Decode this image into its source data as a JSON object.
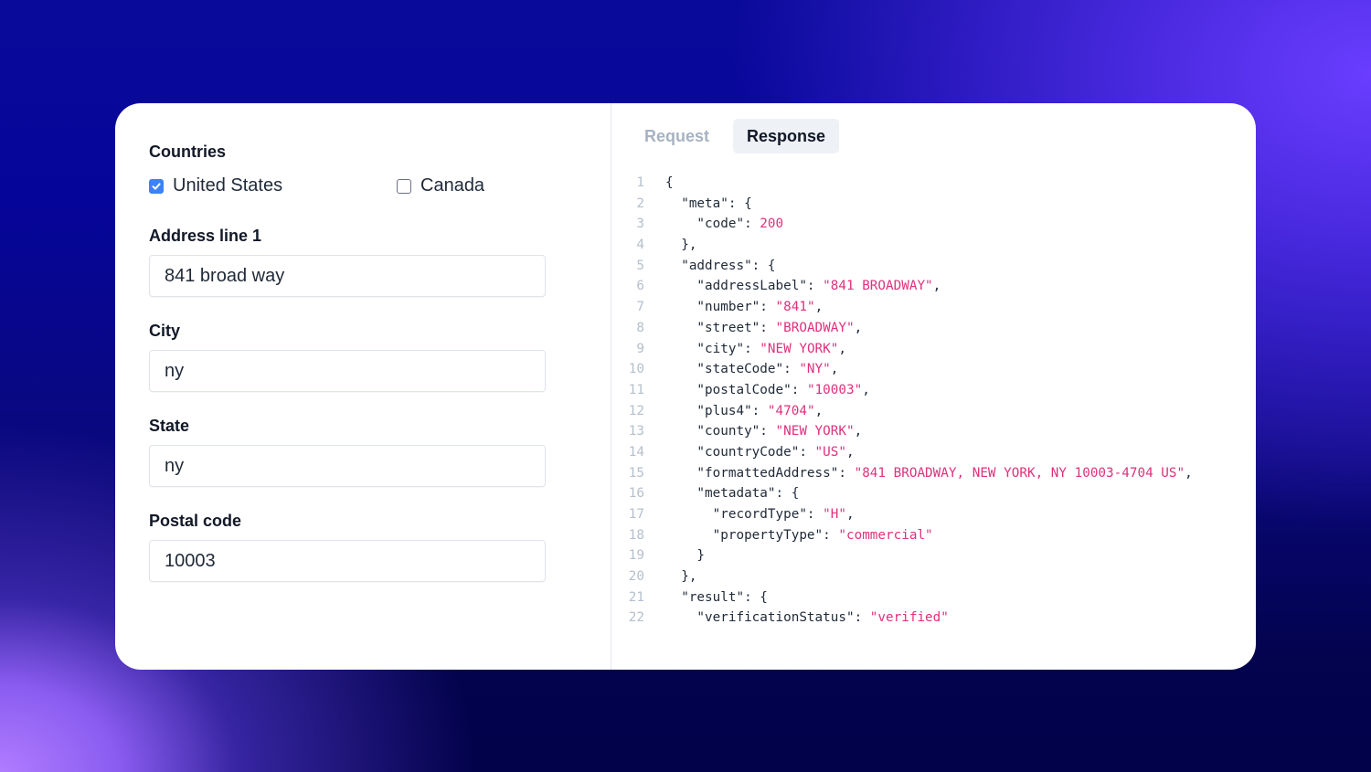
{
  "form": {
    "countries_label": "Countries",
    "countries": [
      {
        "label": "United States",
        "checked": true
      },
      {
        "label": "Canada",
        "checked": false
      }
    ],
    "address_label": "Address line 1",
    "address_value": "841 broad way",
    "city_label": "City",
    "city_value": "ny",
    "state_label": "State",
    "state_value": "ny",
    "postal_label": "Postal code",
    "postal_value": "10003"
  },
  "tabs": [
    {
      "label": "Request",
      "active": false
    },
    {
      "label": "Response",
      "active": true
    }
  ],
  "colors": {
    "accent": "#3b82f6",
    "string": "#e0307c",
    "tab_active_bg": "#eef1f6"
  },
  "code_lines": [
    [
      {
        "t": "{",
        "c": "tx"
      }
    ],
    [
      {
        "t": "  \"meta\": {",
        "c": "tx"
      }
    ],
    [
      {
        "t": "    \"code\": ",
        "c": "tx"
      },
      {
        "t": "200",
        "c": "str"
      }
    ],
    [
      {
        "t": "  },",
        "c": "tx"
      }
    ],
    [
      {
        "t": "  \"address\": {",
        "c": "tx"
      }
    ],
    [
      {
        "t": "    \"addressLabel\": ",
        "c": "tx"
      },
      {
        "t": "\"841 BROADWAY\"",
        "c": "str"
      },
      {
        "t": ",",
        "c": "tx"
      }
    ],
    [
      {
        "t": "    \"number\": ",
        "c": "tx"
      },
      {
        "t": "\"841\"",
        "c": "str"
      },
      {
        "t": ",",
        "c": "tx"
      }
    ],
    [
      {
        "t": "    \"street\": ",
        "c": "tx"
      },
      {
        "t": "\"BROADWAY\"",
        "c": "str"
      },
      {
        "t": ",",
        "c": "tx"
      }
    ],
    [
      {
        "t": "    \"city\": ",
        "c": "tx"
      },
      {
        "t": "\"NEW YORK\"",
        "c": "str"
      },
      {
        "t": ",",
        "c": "tx"
      }
    ],
    [
      {
        "t": "    \"stateCode\": ",
        "c": "tx"
      },
      {
        "t": "\"NY\"",
        "c": "str"
      },
      {
        "t": ",",
        "c": "tx"
      }
    ],
    [
      {
        "t": "    \"postalCode\": ",
        "c": "tx"
      },
      {
        "t": "\"10003\"",
        "c": "str"
      },
      {
        "t": ",",
        "c": "tx"
      }
    ],
    [
      {
        "t": "    \"plus4\": ",
        "c": "tx"
      },
      {
        "t": "\"4704\"",
        "c": "str"
      },
      {
        "t": ",",
        "c": "tx"
      }
    ],
    [
      {
        "t": "    \"county\": ",
        "c": "tx"
      },
      {
        "t": "\"NEW YORK\"",
        "c": "str"
      },
      {
        "t": ",",
        "c": "tx"
      }
    ],
    [
      {
        "t": "    \"countryCode\": ",
        "c": "tx"
      },
      {
        "t": "\"US\"",
        "c": "str"
      },
      {
        "t": ",",
        "c": "tx"
      }
    ],
    [
      {
        "t": "    \"formattedAddress\": ",
        "c": "tx"
      },
      {
        "t": "\"841 BROADWAY, NEW YORK, NY 10003-4704 US\"",
        "c": "str"
      },
      {
        "t": ",",
        "c": "tx"
      }
    ],
    [
      {
        "t": "    \"metadata\": {",
        "c": "tx"
      }
    ],
    [
      {
        "t": "      \"recordType\": ",
        "c": "tx"
      },
      {
        "t": "\"H\"",
        "c": "str"
      },
      {
        "t": ",",
        "c": "tx"
      }
    ],
    [
      {
        "t": "      \"propertyType\": ",
        "c": "tx"
      },
      {
        "t": "\"commercial\"",
        "c": "str"
      }
    ],
    [
      {
        "t": "    }",
        "c": "tx"
      }
    ],
    [
      {
        "t": "  },",
        "c": "tx"
      }
    ],
    [
      {
        "t": "  \"result\": {",
        "c": "tx"
      }
    ],
    [
      {
        "t": "    \"verificationStatus\": ",
        "c": "tx"
      },
      {
        "t": "\"verified\"",
        "c": "str"
      }
    ]
  ]
}
